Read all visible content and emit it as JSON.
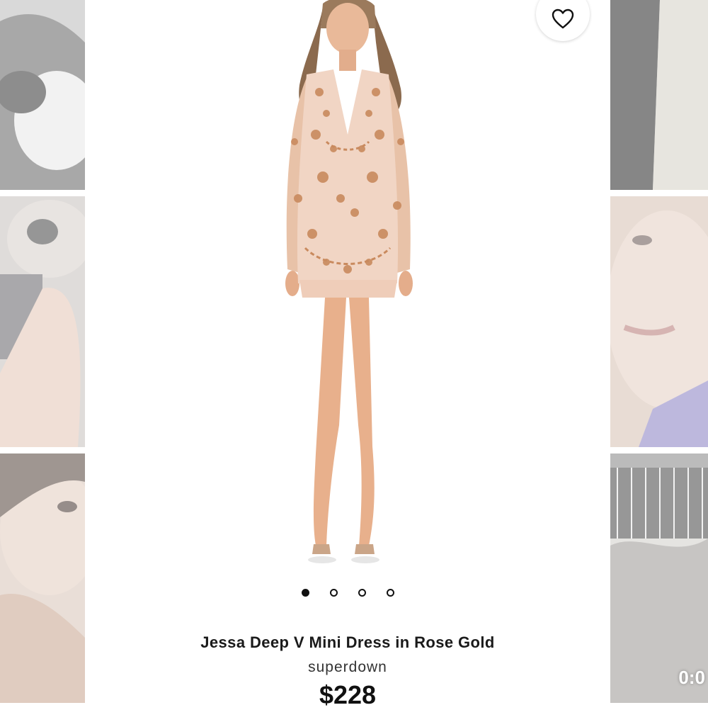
{
  "product": {
    "title": "Jessa Deep V Mini Dress in Rose Gold",
    "brand": "superdown",
    "price": "$228",
    "image_count": 4,
    "active_image": 1
  },
  "favorite": {
    "icon": "heart-outline-icon"
  },
  "background_tiles": {
    "video_duration": "0:0"
  },
  "colors": {
    "text_primary": "#1a1a1a",
    "card_bg": "#ffffff",
    "dress": "#e8b79a",
    "sequin": "#c98a5e"
  }
}
